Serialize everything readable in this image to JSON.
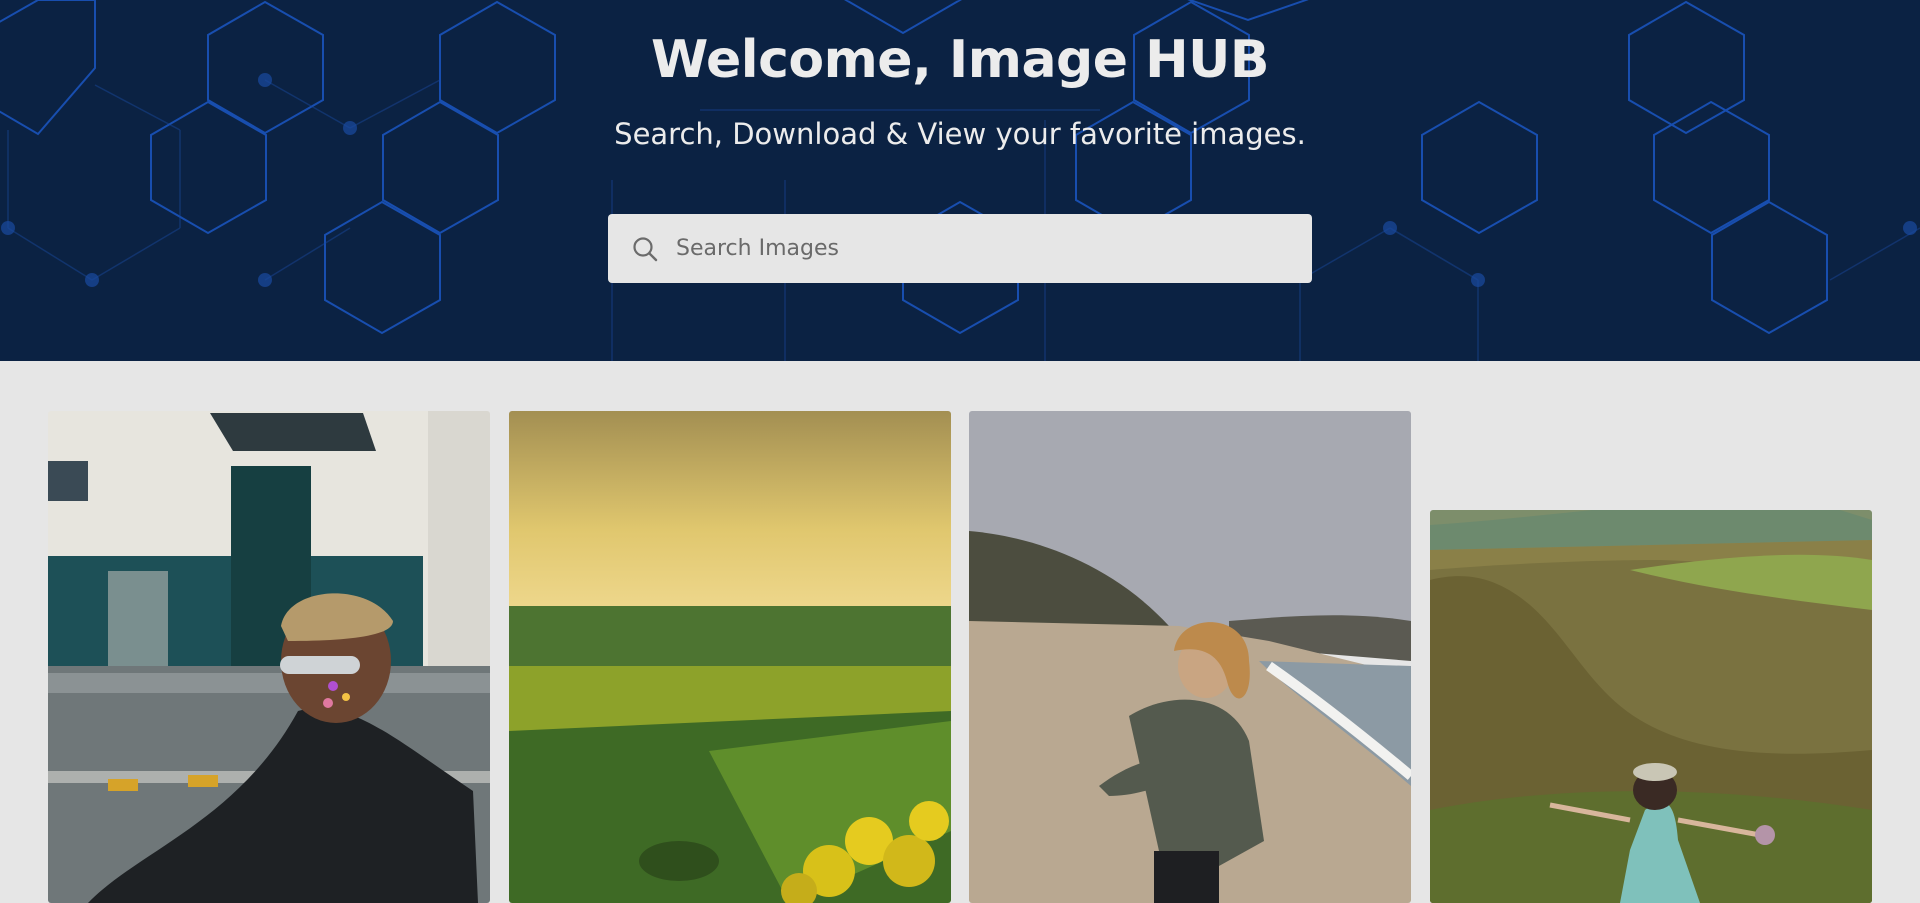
{
  "hero": {
    "title": "Welcome, Image HUB",
    "subtitle": "Search, Download & View your favorite images.",
    "background_color": "#0b2243",
    "pattern_color": "#1b56c2"
  },
  "search": {
    "placeholder": "Search Images",
    "value": "",
    "icon": "search-icon"
  },
  "gallery": {
    "images": [
      {
        "description_key": "man-sunglasses-leather-jacket"
      },
      {
        "description_key": "green-field-sunset"
      },
      {
        "description_key": "woman-on-beach"
      },
      {
        "description_key": "girl-on-green-hills"
      }
    ]
  }
}
